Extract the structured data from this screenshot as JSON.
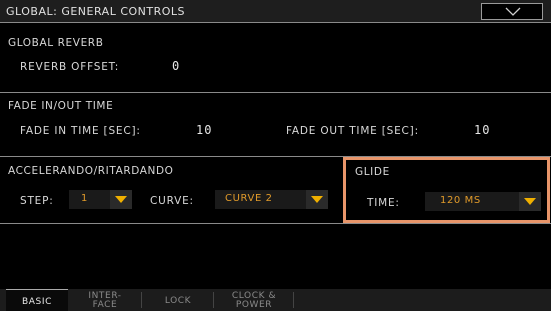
{
  "header": {
    "title": "GLOBAL: GENERAL CONTROLS",
    "menu_icon": "chevron-down-icon"
  },
  "global_reverb": {
    "title": "GLOBAL REVERB",
    "reverb_offset_label": "REVERB OFFSET:",
    "reverb_offset_value": "0"
  },
  "fade": {
    "title": "FADE IN/OUT TIME",
    "fade_in_label": "FADE IN TIME [SEC]:",
    "fade_in_value": "10",
    "fade_out_label": "FADE OUT TIME [SEC]:",
    "fade_out_value": "10"
  },
  "accel": {
    "title": "ACCELERANDO/RITARDANDO",
    "step_label": "STEP:",
    "step_value": "1",
    "curve_label": "CURVE:",
    "curve_value": "CURVE 2"
  },
  "glide": {
    "title": "GLIDE",
    "time_label": "TIME:",
    "time_value": "120 MS"
  },
  "tabs": [
    {
      "label_line1": "BASIC",
      "label_line2": "",
      "active": true
    },
    {
      "label_line1": "INTER-",
      "label_line2": "FACE",
      "active": false
    },
    {
      "label_line1": "LOCK",
      "label_line2": "",
      "active": false
    },
    {
      "label_line1": "CLOCK &",
      "label_line2": "POWER",
      "active": false
    }
  ],
  "colors": {
    "accent_highlight": "#e8956a",
    "dropdown_arrow": "#f0b000",
    "value_text": "#e09a2a"
  }
}
